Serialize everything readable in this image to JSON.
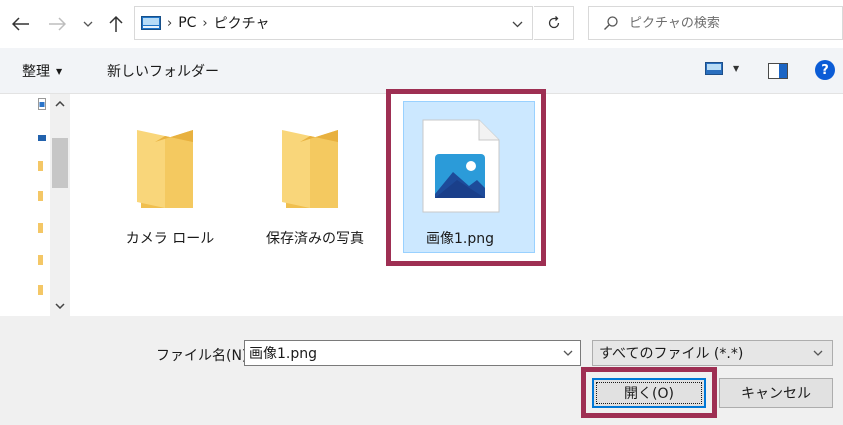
{
  "address_bar": {
    "breadcrumbs": [
      "PC",
      "ピクチャ"
    ],
    "search_placeholder": "ピクチャの検索"
  },
  "toolbar": {
    "organize_label": "整理",
    "new_folder_label": "新しいフォルダー"
  },
  "files": [
    {
      "label": "カメラ ロール",
      "type": "folder"
    },
    {
      "label": "保存済みの写真",
      "type": "folder"
    },
    {
      "label": "画像1.png",
      "type": "image",
      "selected": true
    }
  ],
  "bottom": {
    "filename_label": "ファイル名(N):",
    "filename_value": "画像1.png",
    "file_type_value": "すべてのファイル (*.*)",
    "open_label": "開く(O)",
    "cancel_label": "キャンセル"
  },
  "colors": {
    "highlight": "#9e2f53",
    "selection_bg": "#cce8ff",
    "accent": "#0078d7"
  }
}
